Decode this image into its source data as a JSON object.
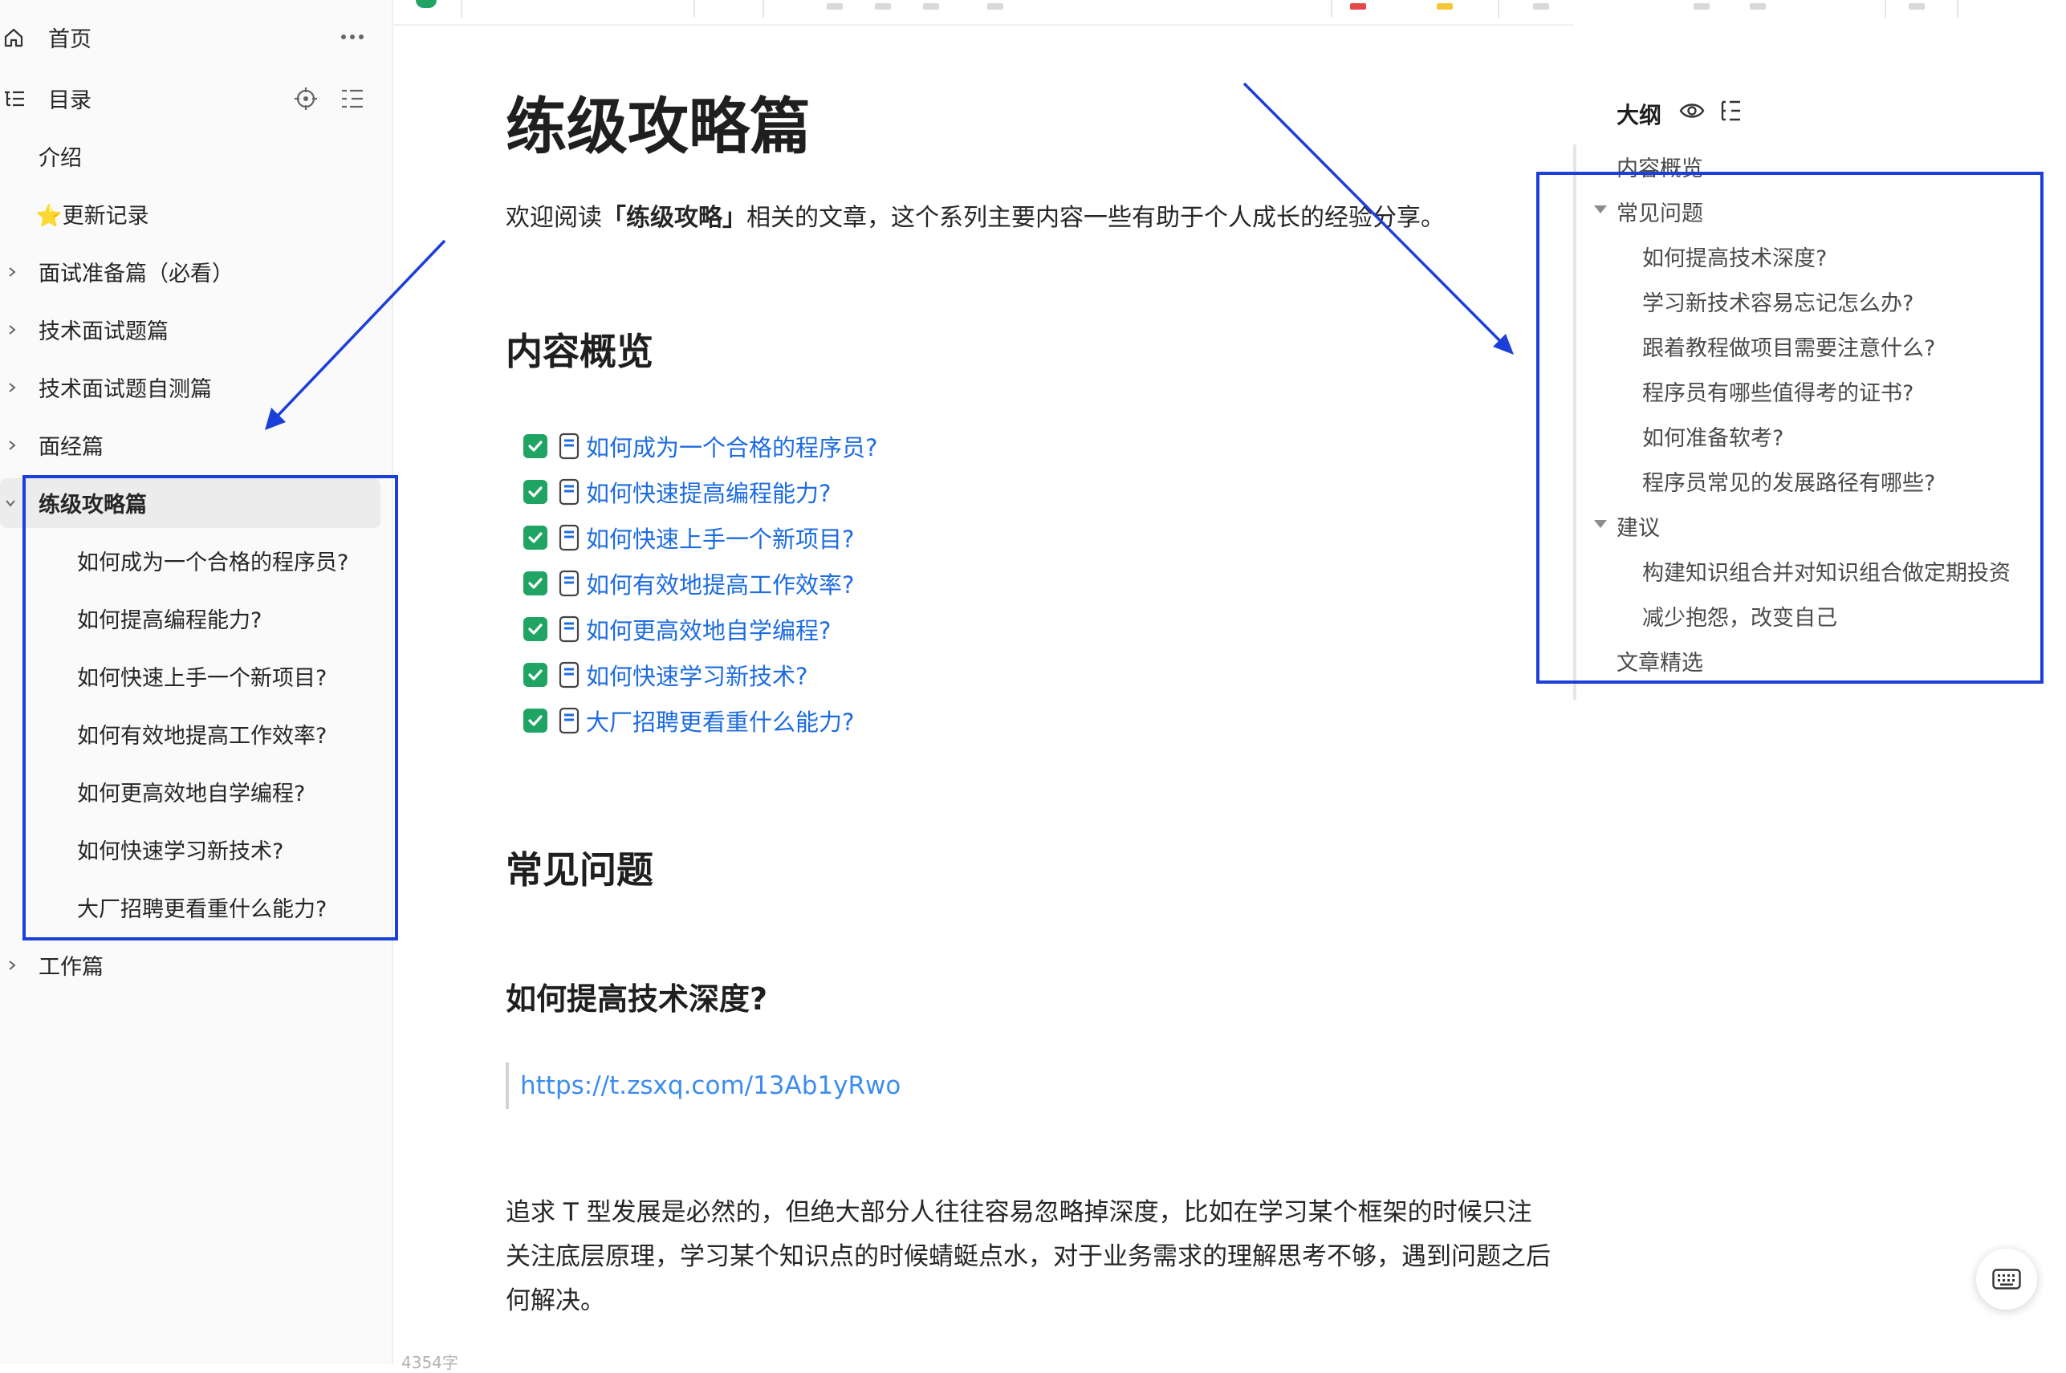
{
  "sidebar": {
    "home_label": "首页",
    "toc_label": "目录",
    "items": [
      {
        "label": "介绍"
      },
      {
        "label": "⭐更新记录"
      },
      {
        "label": "面试准备篇（必看）"
      },
      {
        "label": "技术面试题篇"
      },
      {
        "label": "技术面试题自测篇"
      },
      {
        "label": "面经篇"
      },
      {
        "label": "练级攻略篇"
      },
      {
        "label": "工作篇"
      }
    ],
    "children": [
      {
        "label": "如何成为一个合格的程序员?"
      },
      {
        "label": "如何提高编程能力?"
      },
      {
        "label": "如何快速上手一个新项目?"
      },
      {
        "label": "如何有效地提高工作效率?"
      },
      {
        "label": "如何更高效地自学编程?"
      },
      {
        "label": "如何快速学习新技术?"
      },
      {
        "label": "大厂招聘更看重什么能力?"
      }
    ]
  },
  "doc": {
    "title": "练级攻略篇",
    "intro_prefix": "欢迎阅读",
    "intro_bold": "「练级攻略」",
    "intro_suffix": "相关的文章，这个系列主要内容一些有助于个人成长的经验分享。",
    "h2_overview": "内容概览",
    "tasks": [
      {
        "label": "如何成为一个合格的程序员?"
      },
      {
        "label": "如何快速提高编程能力?"
      },
      {
        "label": "如何快速上手一个新项目?"
      },
      {
        "label": "如何有效地提高工作效率?"
      },
      {
        "label": "如何更高效地自学编程?"
      },
      {
        "label": "如何快速学习新技术?"
      },
      {
        "label": "大厂招聘更看重什么能力?"
      }
    ],
    "h2_faq": "常见问题",
    "h3_depth": "如何提高技术深度?",
    "link": "https://t.zsxq.com/13Ab1yRwo",
    "para_lines": [
      "追求 T 型发展是必然的，但绝大部分人往往容易忽略掉深度，比如在学习某个框架的时候只注",
      "关注底层原理，学习某个知识点的时候蜻蜓点水，对于业务需求的理解思考不够，遇到问题之后",
      "何解决。"
    ],
    "word_count": "4354字"
  },
  "outline": {
    "title": "大纲",
    "items": [
      {
        "label": "内容概览"
      },
      {
        "label": "常见问题"
      },
      {
        "label": "如何提高技术深度?"
      },
      {
        "label": "学习新技术容易忘记怎么办?"
      },
      {
        "label": "跟着教程做项目需要注意什么?"
      },
      {
        "label": "程序员有哪些值得考的证书?"
      },
      {
        "label": "如何准备软考?"
      },
      {
        "label": "程序员常见的发展路径有哪些?"
      },
      {
        "label": "建议"
      },
      {
        "label": "构建知识组合并对知识组合做定期投资"
      },
      {
        "label": "减少抱怨，改变自己"
      },
      {
        "label": "文章精选"
      }
    ]
  },
  "colors": {
    "accent_link": "#1d6ce0",
    "checkbox": "#1fa463",
    "annotation": "#1c3fd8"
  }
}
